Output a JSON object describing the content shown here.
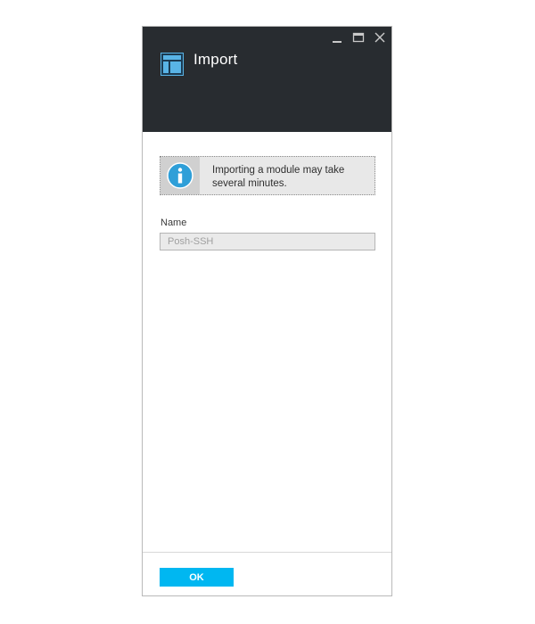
{
  "blade": {
    "title": "Import",
    "icon": "module-blade-icon",
    "window_controls": [
      "minimize-icon",
      "maximize-icon",
      "close-icon"
    ]
  },
  "info": {
    "icon": "info-icon",
    "message": "Importing a module may take several minutes."
  },
  "form": {
    "name_label": "Name",
    "name_value": "Posh-SSH"
  },
  "footer": {
    "ok_label": "OK"
  },
  "colors": {
    "header_bg": "#282c30",
    "accent": "#00b7f1",
    "info_icon": "#2f9fd8"
  }
}
